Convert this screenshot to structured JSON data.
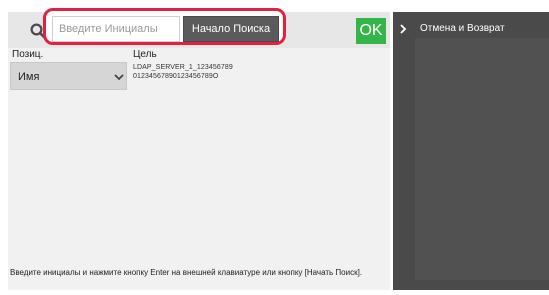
{
  "search": {
    "placeholder": "Введите Инициалы",
    "start_label": "Начало Поиска",
    "ok_label": "OK"
  },
  "columns": {
    "position": "Позиц.",
    "target": "Цель"
  },
  "select": {
    "value": "Имя"
  },
  "target_entry": {
    "line1": "LDAP_SERVER_1_123456789",
    "line2": "01234567890123456789O"
  },
  "footer": {
    "text": "Введите инициалы и нажмите кнопку Enter на внешней клавиатуре или кнопку [Начать Поиск]."
  },
  "sidebar": {
    "cancel_return_label": "Отмена и Возврат"
  },
  "colors": {
    "highlight": "#e3213f",
    "ok_green": "#35b44a",
    "sidebar": "#4a4a4a"
  },
  "icons": {
    "search": "search-icon",
    "chevron_down": "chevron-down-icon",
    "chevron_right": "chevron-right-icon"
  }
}
